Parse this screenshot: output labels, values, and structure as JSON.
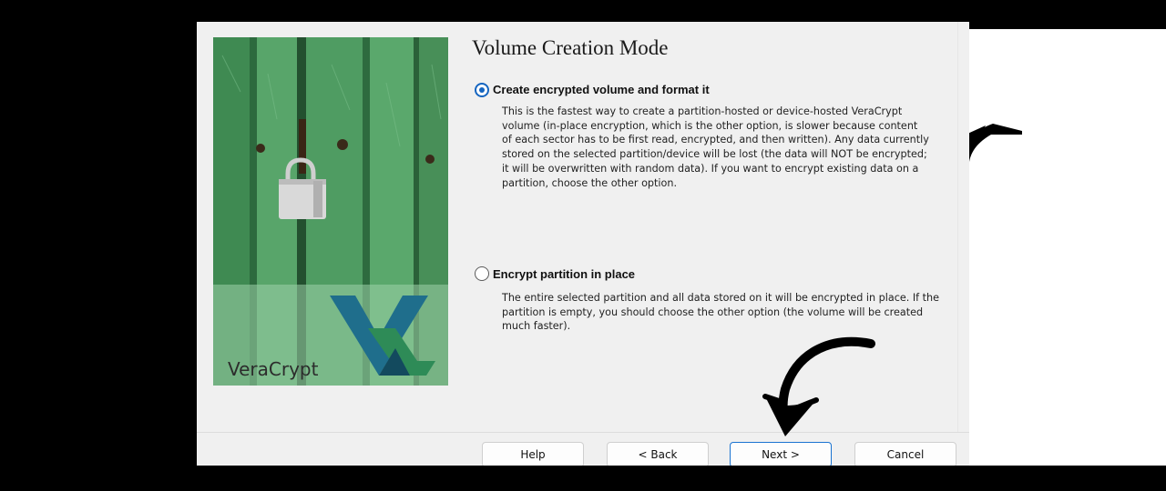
{
  "dialog": {
    "title": "Volume Creation Mode",
    "banner": {
      "brand": "VeraCrypt"
    },
    "options": [
      {
        "label": "Create encrypted volume and format it",
        "selected": true,
        "description": "This is the fastest way to create a partition-hosted or device-hosted VeraCrypt volume (in-place encryption, which is the other option, is slower because content of each sector has to be first read, encrypted, and then written). Any data currently stored on the selected partition/device will be lost (the data will NOT be encrypted; it will be overwritten with random data). If you want to encrypt existing data on a partition, choose the other option."
      },
      {
        "label": "Encrypt partition in place",
        "selected": false,
        "description": "The entire selected partition and all data stored on it will be encrypted in place. If the partition is empty, you should choose the other option (the volume will be created much faster)."
      }
    ],
    "buttons": {
      "help": "Help",
      "back": "< Back",
      "next": "Next >",
      "cancel": "Cancel"
    }
  },
  "annotations": {
    "arrow_color": "#000000"
  },
  "colors": {
    "accent": "#1565c0",
    "door_green": "#3c8f55"
  }
}
